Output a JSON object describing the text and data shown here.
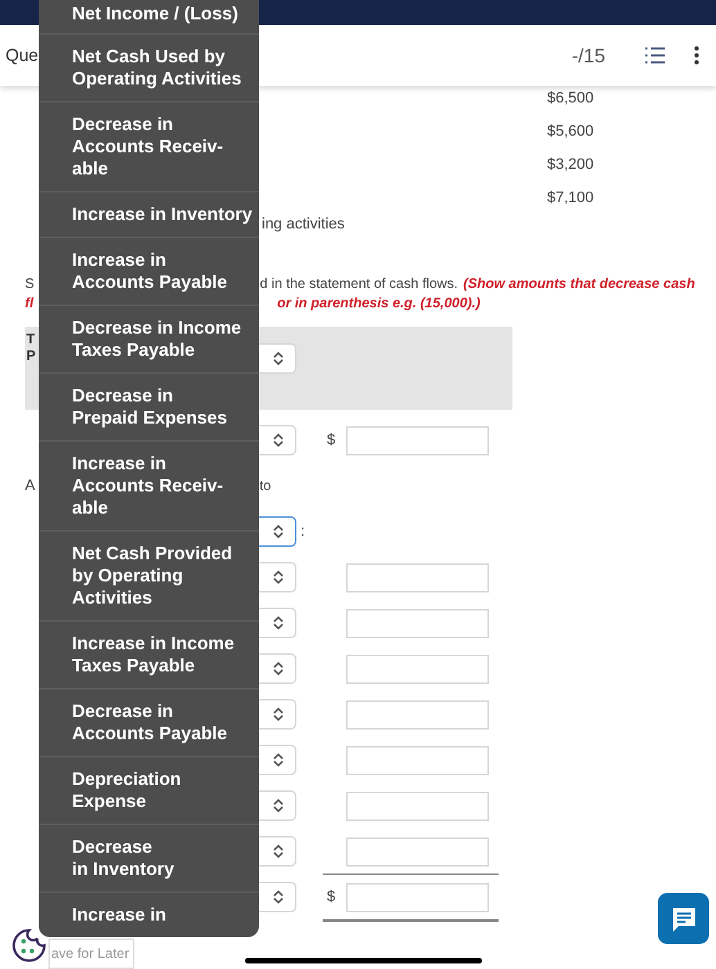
{
  "header": {
    "question_label": "Que",
    "progress": "-/15"
  },
  "amounts": [
    "$6,500",
    "$5,600",
    "$3,200",
    "$7,100"
  ],
  "section_text": "ing activities",
  "instruction": {
    "lead": "S",
    "text": "d in the statement of cash flows.",
    "note_1": "(Show amounts that decrease cash",
    "lead_2": "fl",
    "note_2": "or in parenthesis e.g. (15,000).)"
  },
  "panel": {
    "line_1": "T",
    "line_2": "P"
  },
  "rows": [
    {
      "kind": "entry",
      "currency": "$"
    },
    {
      "kind": "text",
      "lead": "A",
      "tail": "to"
    },
    {
      "kind": "select",
      "focused": true,
      "suffix": ":"
    },
    {
      "kind": "entry"
    },
    {
      "kind": "entry"
    },
    {
      "kind": "entry"
    },
    {
      "kind": "entry"
    },
    {
      "kind": "entry"
    },
    {
      "kind": "entry"
    },
    {
      "kind": "entry"
    },
    {
      "kind": "total",
      "currency": "$"
    }
  ],
  "menu": [
    [
      "Net Income / (Loss)"
    ],
    [
      "Net Cash Used by",
      "Operating Activities"
    ],
    [
      "Decrease in",
      "Accounts Receiv-",
      "able"
    ],
    [
      "Increase in Inventory"
    ],
    [
      "Increase in",
      "Accounts Payable"
    ],
    [
      "Decrease in Income",
      "Taxes Payable"
    ],
    [
      "Decrease in",
      "Prepaid Expenses"
    ],
    [
      "Increase in",
      "Accounts Receiv-",
      "able"
    ],
    [
      "Net Cash Provided",
      "by Operating",
      "Activities"
    ],
    [
      "Increase in Income",
      "Taxes Payable"
    ],
    [
      "Decrease in",
      "Accounts Payable"
    ],
    [
      "Depreciation",
      "Expense"
    ],
    [
      "Decrease",
      "in Inventory"
    ],
    [
      "Increase in"
    ]
  ],
  "save_label": "ave for Later"
}
